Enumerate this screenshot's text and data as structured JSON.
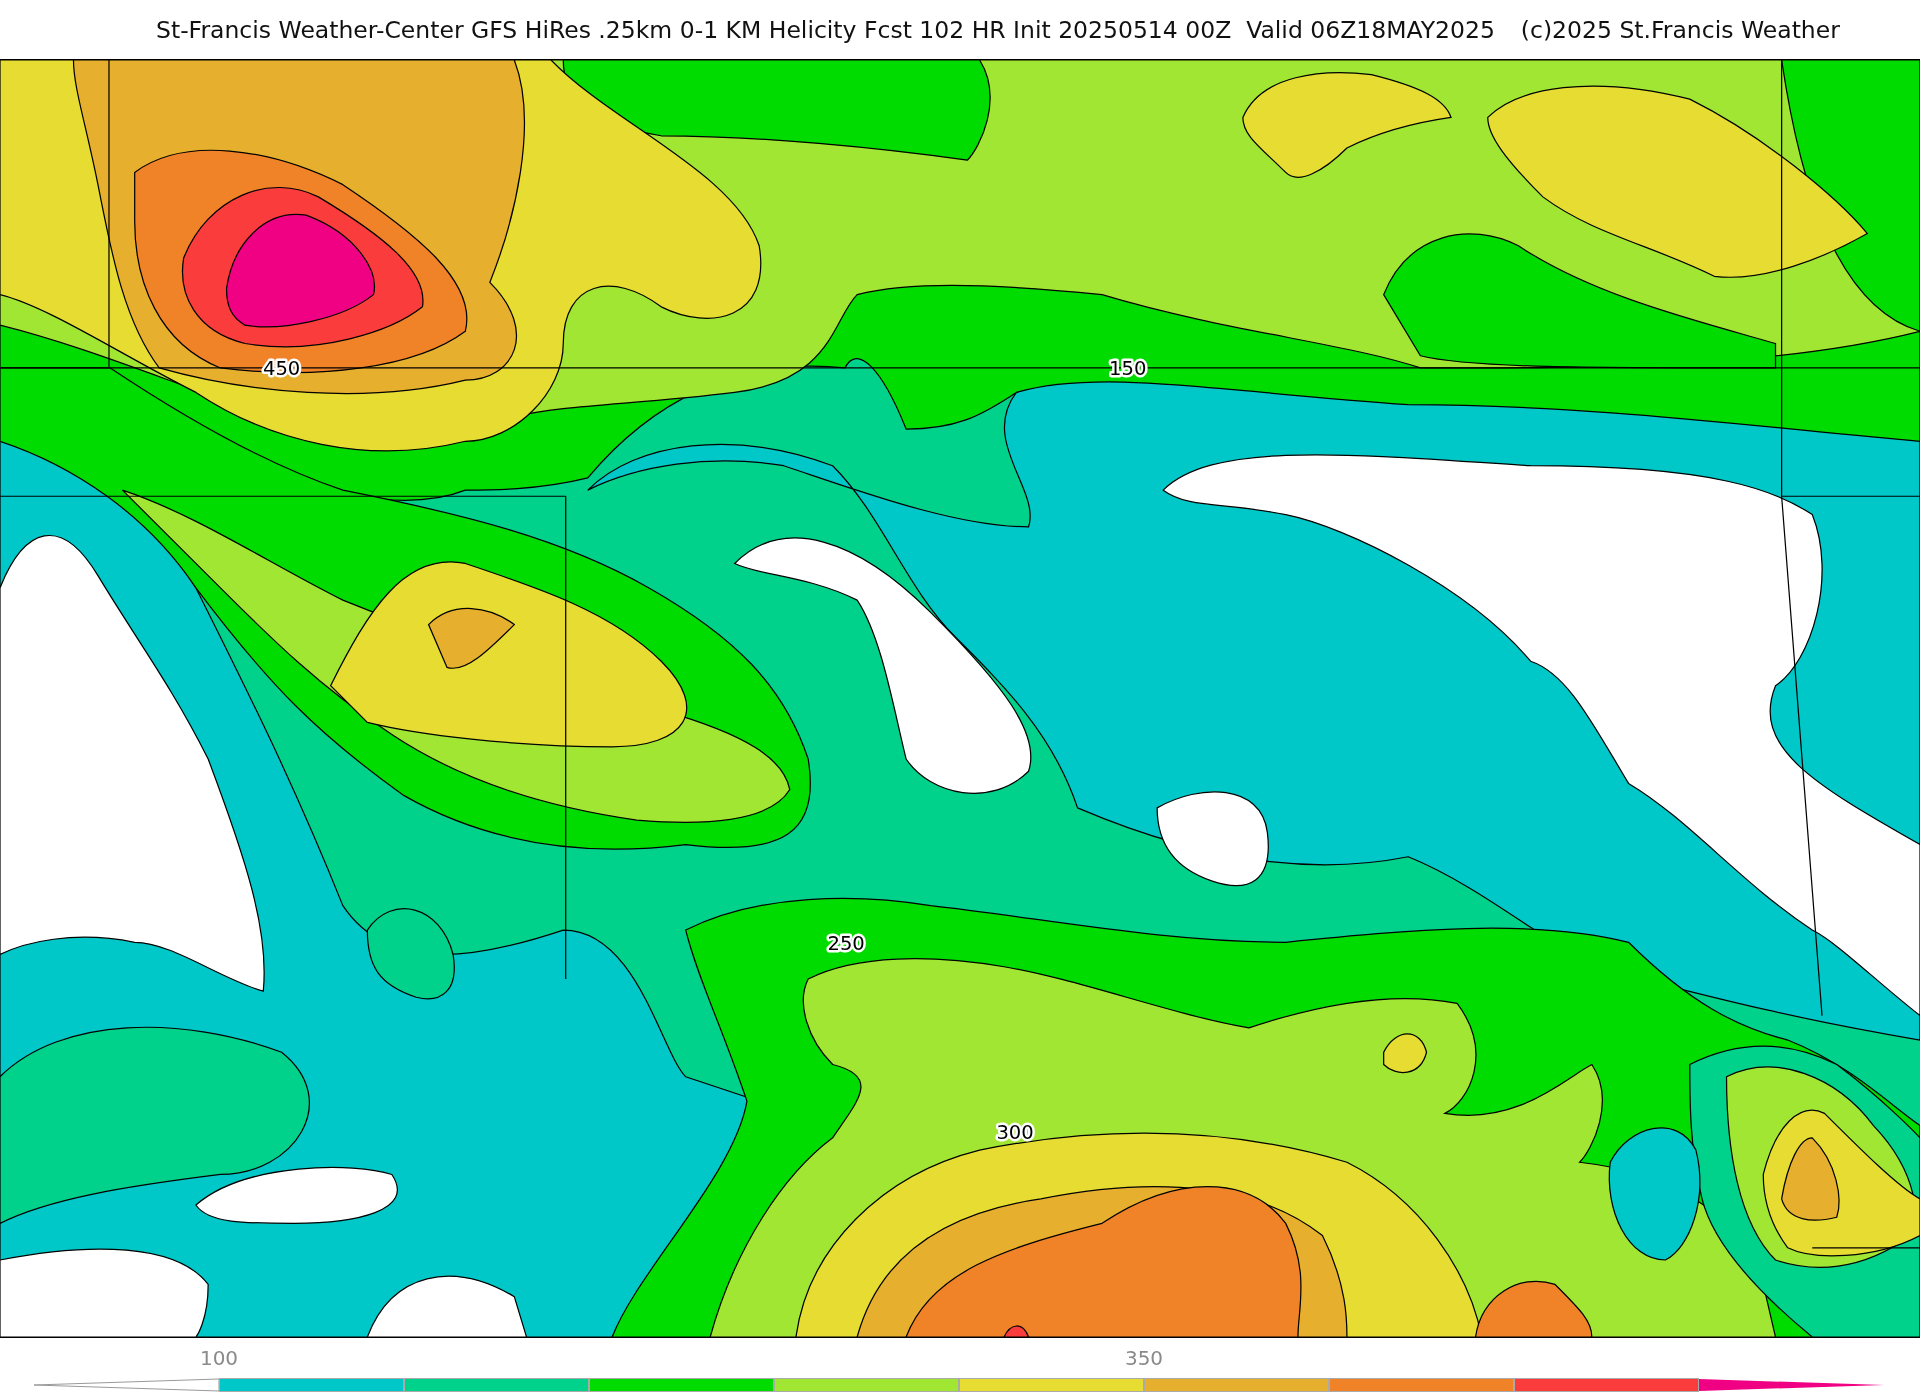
{
  "title": "St-Francis Weather-Center GFS HiRes .25km 0-1 KM Helicity Fcst 102 HR Init 20250514 00Z  Valid 06Z18MAY2025",
  "copyright": "(c)2025 St.Francis Weather",
  "contour_labels": [
    {
      "text": "450"
    },
    {
      "text": "150"
    },
    {
      "text": "250"
    },
    {
      "text": "300"
    }
  ],
  "colorbar": {
    "bins": [
      {
        "kind": "under",
        "color": "#ffffff"
      },
      {
        "kind": "bin",
        "color": "#00c8c8",
        "tick": "100"
      },
      {
        "kind": "bin",
        "color": "#00d28c"
      },
      {
        "kind": "bin",
        "color": "#00dc00"
      },
      {
        "kind": "bin",
        "color": "#a0e632"
      },
      {
        "kind": "bin",
        "color": "#e6dc32"
      },
      {
        "kind": "bin",
        "color": "#e6af2d",
        "tick": "350"
      },
      {
        "kind": "bin",
        "color": "#f08228"
      },
      {
        "kind": "bin",
        "color": "#fa3c3c"
      },
      {
        "kind": "over",
        "color": "#f00082"
      }
    ]
  }
}
